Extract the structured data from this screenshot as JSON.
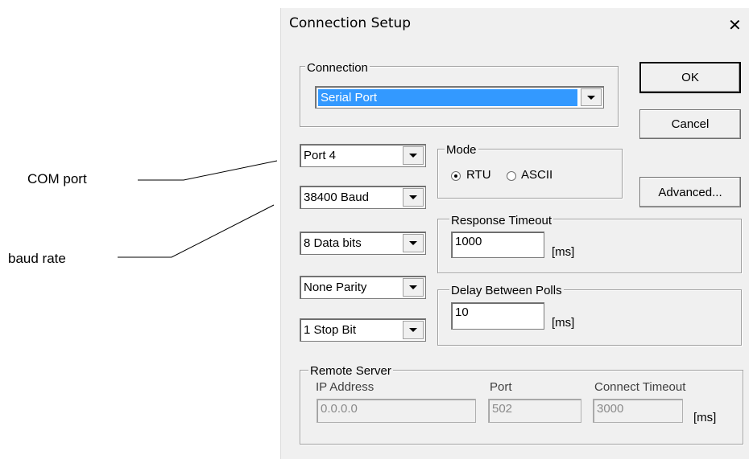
{
  "annotations": {
    "com_port": "COM port",
    "baud_rate": "baud rate"
  },
  "dialog": {
    "title": "Connection Setup",
    "close_glyph": "✕"
  },
  "connection": {
    "legend": "Connection",
    "selected": "Serial Port"
  },
  "buttons": {
    "ok": "OK",
    "cancel": "Cancel",
    "advanced": "Advanced..."
  },
  "serial": {
    "port": "Port 4",
    "baud": "38400 Baud",
    "data_bits": "8 Data bits",
    "parity": "None Parity",
    "stop_bits": "1 Stop Bit"
  },
  "mode": {
    "legend": "Mode",
    "rtu": "RTU",
    "ascii": "ASCII",
    "selected": "RTU"
  },
  "response_timeout": {
    "legend": "Response Timeout",
    "value": "1000",
    "unit": "[ms]"
  },
  "delay_between_polls": {
    "legend": "Delay Between Polls",
    "value": "10",
    "unit": "[ms]"
  },
  "remote_server": {
    "legend": "Remote Server",
    "ip_label": "IP Address",
    "ip_value": "0.0.0.0",
    "port_label": "Port",
    "port_value": "502",
    "timeout_label": "Connect Timeout",
    "timeout_value": "3000",
    "timeout_unit": "[ms]"
  }
}
